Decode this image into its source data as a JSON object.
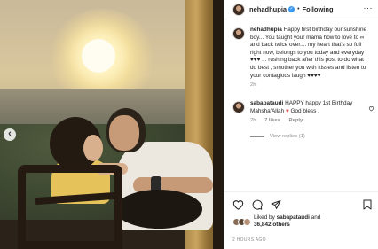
{
  "post": {
    "username": "nehadhupia",
    "verified_mark": "✓",
    "separator": "•",
    "follow_status": "Following",
    "more_label": "···"
  },
  "caption": {
    "username": "nehadhupia",
    "text": "Happy first birthday our sunshine boy... You taught your mama how to love to ∞ and back twice over.... my heart that's so full right now, belongs to you today and everyday ♥♥♥ ... rushing back after this post to do what I do best , smother you with kisses and listen to your contagious laugh ♥♥♥♥",
    "time": "2h"
  },
  "comment": {
    "username": "sabapataudi",
    "text_before": "HAPPY happy 1st Birthday Mahsha'Allah",
    "heart": "♥",
    "text_after": "God bless .",
    "time": "2h",
    "likes": "7 likes",
    "reply_label": "Reply",
    "view_replies": "View replies (1)"
  },
  "actions": {
    "like_icon": "heart-outline-icon",
    "comment_icon": "comment-icon",
    "share_icon": "paper-plane-icon",
    "save_icon": "bookmark-icon"
  },
  "likes": {
    "prefix": "Liked by ",
    "user": "sabapataudi",
    "and": " and",
    "count": "36,842 others"
  },
  "timestamp": "2 HOURS AGO",
  "carousel": {
    "prev_arrow": "‹"
  },
  "colors": {
    "verified": "#3897f0",
    "heart": "#ed4956",
    "muted": "#8e8e8e",
    "text": "#262626"
  }
}
